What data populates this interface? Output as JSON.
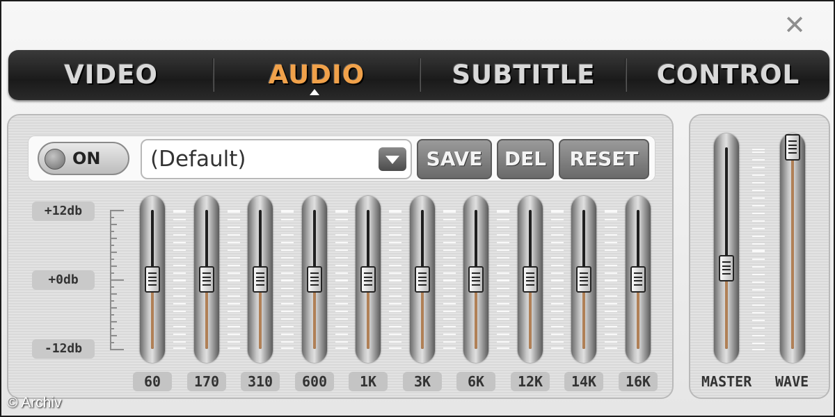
{
  "window": {
    "close_icon": "close-icon"
  },
  "tabs": [
    {
      "label": "VIDEO",
      "active": false
    },
    {
      "label": "AUDIO",
      "active": true
    },
    {
      "label": "SUBTITLE",
      "active": false
    },
    {
      "label": "CONTROL",
      "active": false
    }
  ],
  "equalizer": {
    "power_toggle": {
      "label": "ON",
      "state": "on"
    },
    "preset": {
      "value": "(Default)"
    },
    "buttons": {
      "save": "SAVE",
      "del": "DEL",
      "reset": "RESET"
    },
    "db_scale": {
      "top": "+12db",
      "mid": "+0db",
      "bottom": "-12db"
    },
    "bands": [
      {
        "label": "60",
        "gain_db": 0
      },
      {
        "label": "170",
        "gain_db": 0
      },
      {
        "label": "310",
        "gain_db": 0
      },
      {
        "label": "600",
        "gain_db": 0
      },
      {
        "label": "1K",
        "gain_db": 0
      },
      {
        "label": "3K",
        "gain_db": 0
      },
      {
        "label": "6K",
        "gain_db": 0
      },
      {
        "label": "12K",
        "gain_db": 0
      },
      {
        "label": "14K",
        "gain_db": 0
      },
      {
        "label": "16K",
        "gain_db": 0
      }
    ]
  },
  "mixer": {
    "master": {
      "label": "MASTER",
      "level": 0.4
    },
    "wave": {
      "label": "WAVE",
      "level": 1.0
    }
  },
  "credit": "© Archiv",
  "colors": {
    "active_tab": "#f0a14a",
    "slider_fill": "#b08056"
  }
}
